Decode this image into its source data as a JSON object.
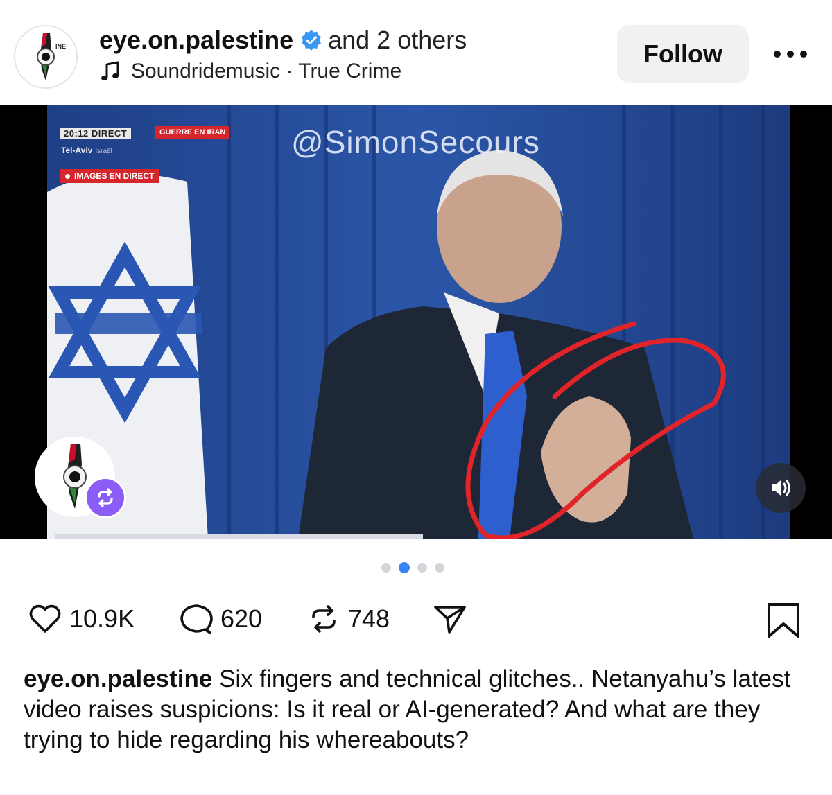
{
  "post": {
    "username": "eye.on.palestine",
    "coauthors": "and 2 others",
    "audio": "Soundridemusic · True Crime",
    "follow_label": "Follow",
    "more_icon": "more-horizontal-icon"
  },
  "media": {
    "broadcast": {
      "time": "20:12 DIRECT",
      "breaking": "GUERRE EN IRAN",
      "location": "Tel-Aviv",
      "location_sub": "Israël",
      "live": "IMAGES EN DIRECT"
    },
    "watermark": "@SimonSecours",
    "repost_badge_icon": "repost-icon",
    "sound_icon": "speaker-icon",
    "slides_total": 4,
    "slide_active": 2
  },
  "actions": {
    "likes": "10.9K",
    "comments": "620",
    "reposts": "748",
    "share_icon": "send-icon",
    "bookmark_icon": "bookmark-icon"
  },
  "caption": {
    "user": "eye.on.palestine",
    "text": "Six fingers and technical glitches.. Netanyahu’s latest video raises suspicions: Is it real or AI-generated? And what are they trying to hide regarding his whereabouts?"
  },
  "colors": {
    "verified": "#3897f0",
    "active_dot": "#3b82f6",
    "repost_badge": "#8b5cf6",
    "follow_bg": "#f0f1f3",
    "annotation_red": "#e0242a"
  }
}
